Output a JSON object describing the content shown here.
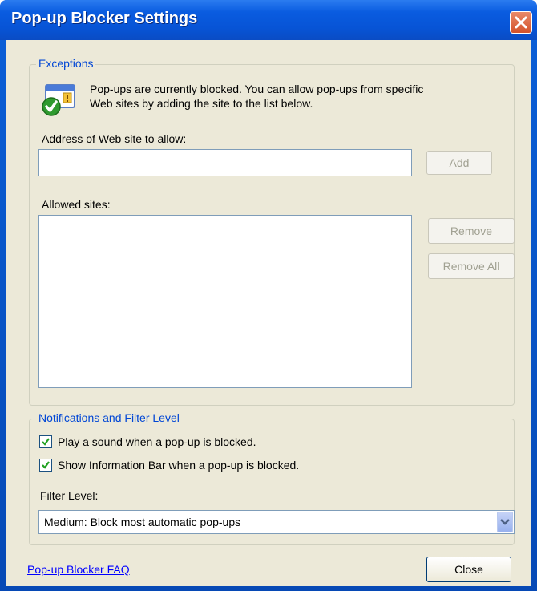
{
  "window": {
    "title": "Pop-up Blocker Settings"
  },
  "exceptions": {
    "legend": "Exceptions",
    "info_line1": "Pop-ups are currently blocked.  You can allow pop-ups from specific",
    "info_line2": "Web sites by adding the site to the list below.",
    "address_label": "Address of Web site to allow:",
    "address_value": "",
    "add_label": "Add",
    "allowed_label": "Allowed sites:",
    "remove_label": "Remove",
    "remove_all_label": "Remove All"
  },
  "notifications": {
    "legend": "Notifications and Filter Level",
    "play_sound_label": "Play a sound when a pop-up is blocked.",
    "play_sound_checked": true,
    "info_bar_label": "Show Information Bar when a pop-up is blocked.",
    "info_bar_checked": true,
    "filter_label": "Filter Level:",
    "filter_value": "Medium: Block most automatic pop-ups"
  },
  "footer": {
    "faq_link": "Pop-up Blocker FAQ",
    "close_label": "Close"
  },
  "icons": {
    "title_close": "close-icon",
    "info": "popup-blocked-shield-icon",
    "checkbox": "checkmark-icon",
    "dropdown": "chevron-down-icon"
  },
  "colors": {
    "titlebar": "#0a5ce0",
    "group_legend": "#0046d5",
    "link": "#0000ff",
    "dialog_bg": "#ece9d8"
  }
}
